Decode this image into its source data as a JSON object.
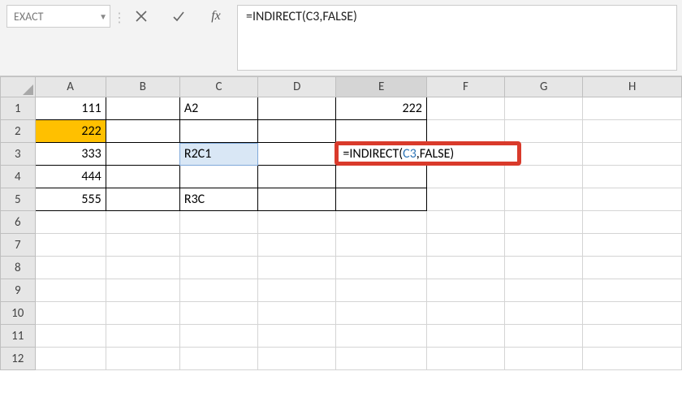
{
  "formula_bar": {
    "name_box": "EXACT",
    "cancel_tooltip": "Cancel",
    "enter_tooltip": "Enter",
    "fx_label": "fx",
    "formula": "=INDIRECT(C3,FALSE)"
  },
  "columns": [
    "A",
    "B",
    "C",
    "D",
    "E",
    "F",
    "G",
    "H"
  ],
  "rows": [
    "1",
    "2",
    "3",
    "4",
    "5",
    "6",
    "7",
    "8",
    "9",
    "10",
    "11",
    "12"
  ],
  "cells": {
    "A1": "111",
    "A2": "222",
    "A3": "333",
    "A4": "444",
    "A5": "555",
    "C1": "A2",
    "C3": "R2C1",
    "C5": "R3C",
    "E1": "222"
  },
  "editing": {
    "cell": "E3",
    "prefix": "=INDIRECT(",
    "ref": "C3",
    "suffix": ",FALSE)"
  },
  "active_column": "E",
  "highlighted_ref_cell": "C3",
  "yellow_cell": "A2"
}
